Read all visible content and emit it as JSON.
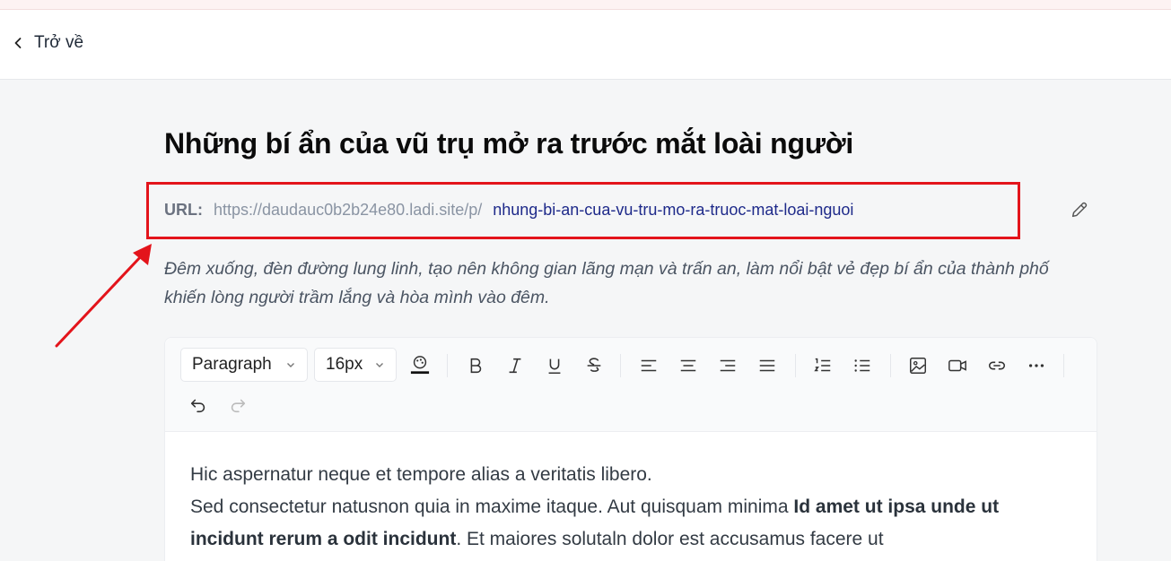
{
  "header": {
    "back_label": "Trở về"
  },
  "page": {
    "title": "Những bí ẩn của vũ trụ mở ra trước mắt loài người",
    "url_label": "URL:",
    "url_base": "https://daudauc0b2b24e80.ladi.site/p/",
    "url_slug": "nhung-bi-an-cua-vu-tru-mo-ra-truoc-mat-loai-nguoi",
    "description": "Đêm xuống, đèn đường lung linh, tạo nên không gian lãng mạn và trấn an, làm nổi bật vẻ đẹp bí ẩn của thành phố khiến lòng người trầm lắng và hòa mình vào đêm."
  },
  "toolbar": {
    "block_format": "Paragraph",
    "font_size": "16px"
  },
  "content": {
    "line1": "Hic aspernatur neque et tempore alias a veritatis libero.",
    "line2_start": "Sed consectetur natusnon quia in maxime itaque. Aut quisquam minima ",
    "line2_bold": "Id amet ut ipsa unde ut incidunt rerum a odit incidunt",
    "line2_end": ". Et maiores solutaln dolor est accusamus facere ut"
  },
  "colors": {
    "highlight": "#e3141b",
    "slug": "#1e2a8a"
  }
}
